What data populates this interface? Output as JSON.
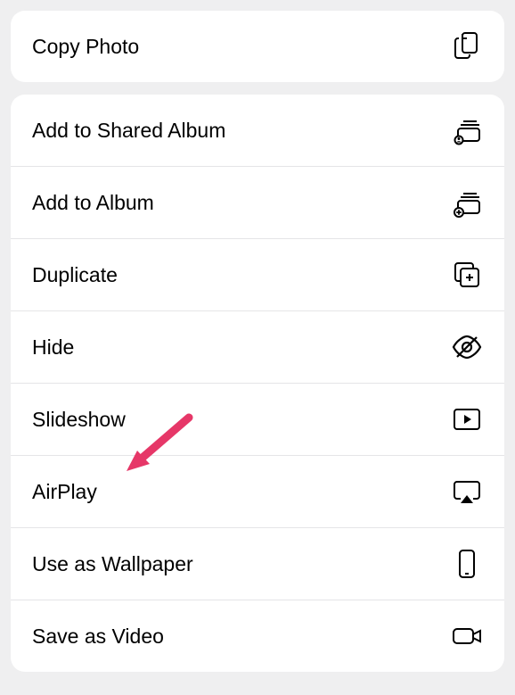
{
  "group1": {
    "items": [
      {
        "label": "Copy Photo",
        "icon": "copy-icon"
      }
    ]
  },
  "group2": {
    "items": [
      {
        "label": "Add to Shared Album",
        "icon": "shared-album-icon"
      },
      {
        "label": "Add to Album",
        "icon": "add-album-icon"
      },
      {
        "label": "Duplicate",
        "icon": "duplicate-icon"
      },
      {
        "label": "Hide",
        "icon": "hide-icon"
      },
      {
        "label": "Slideshow",
        "icon": "slideshow-icon"
      },
      {
        "label": "AirPlay",
        "icon": "airplay-icon"
      },
      {
        "label": "Use as Wallpaper",
        "icon": "phone-icon"
      },
      {
        "label": "Save as Video",
        "icon": "video-icon"
      }
    ]
  },
  "annotation": {
    "target": "AirPlay",
    "color": "#e63768"
  }
}
